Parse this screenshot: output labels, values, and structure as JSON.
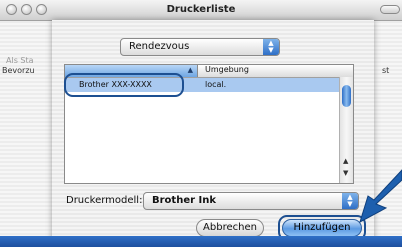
{
  "window": {
    "title": "Druckerliste"
  },
  "background_window": {
    "left_label_1": "Als Sta",
    "left_label_2": "Bevorzu",
    "right_label": "st"
  },
  "sheet": {
    "connection_popup": {
      "value": "Rendezvous"
    },
    "printer_list": {
      "columns": [
        "",
        "Umgebung"
      ],
      "rows": [
        {
          "name": "Brother  XXX-XXXX",
          "location": "local."
        }
      ]
    },
    "model": {
      "label": "Druckermodell:",
      "value": "Brother Ink"
    },
    "buttons": {
      "cancel": "Abbrechen",
      "add": "Hinzufügen"
    }
  },
  "colors": {
    "accent": "#2f6fc7",
    "selection": "#a9c9f0",
    "annotation": "#1d4f91"
  }
}
